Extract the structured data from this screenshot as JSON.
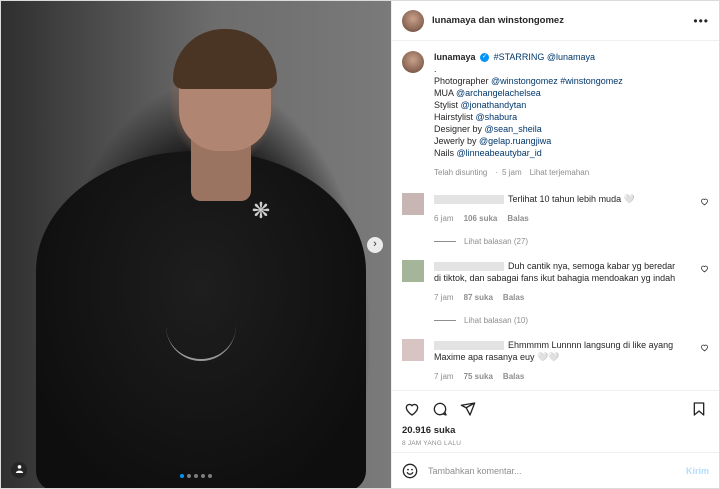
{
  "media": {
    "next_glyph": "›",
    "dots": 5,
    "active_dot": 1
  },
  "header": {
    "names": "lunamaya dan winstongomez",
    "more": "•••"
  },
  "caption": {
    "username": "lunamaya",
    "verified": "✓",
    "first_line": "#STARRING @lunamaya",
    "dot_line": ".",
    "lines": [
      {
        "prefix": "Photographer ",
        "link": "@winstongomez #winstongomez"
      },
      {
        "prefix": "MUA ",
        "link": "@archangelachelsea"
      },
      {
        "prefix": "Stylist ",
        "link": "@jonathandytan"
      },
      {
        "prefix": "Hairstylist ",
        "link": "@shabura"
      },
      {
        "prefix": "Designer by ",
        "link": "@sean_sheila"
      },
      {
        "prefix": "Jewerly by ",
        "link": "@gelap.ruangjiwa"
      },
      {
        "prefix": "Nails ",
        "link": "@linneabeautybar_id"
      }
    ],
    "edited": "Telah disunting",
    "dot": "·",
    "time": "5 jam",
    "translate": "Lihat terjemahan"
  },
  "comments": [
    {
      "text": "Terlihat 10 tahun lebih muda 🤍",
      "time": "6 jam",
      "likes": "106 suka",
      "reply": "Balas",
      "replies_label": "Lihat balasan (27)"
    },
    {
      "text": "Duh cantik nya, semoga kabar yg beredar di tiktok, dan sabagai fans ikut bahagia mendoakan yg indah",
      "time": "7 jam",
      "likes": "87 suka",
      "reply": "Balas",
      "replies_label": "Lihat balasan (10)"
    },
    {
      "text": "Ehmmmm Lunnnn langsung di like ayang Maxime apa rasanya euy 🤍🤍",
      "time": "7 jam",
      "likes": "75 suka",
      "reply": "Balas"
    }
  ],
  "actions": {
    "likes": "20.916 suka",
    "time_ago": "8 JAM YANG LALU"
  },
  "add_comment": {
    "placeholder": "Tambahkan komentar...",
    "send": "Kirim"
  },
  "colors": {
    "link": "#00376b",
    "accent": "#0095f6",
    "muted": "#8e8e8e"
  }
}
